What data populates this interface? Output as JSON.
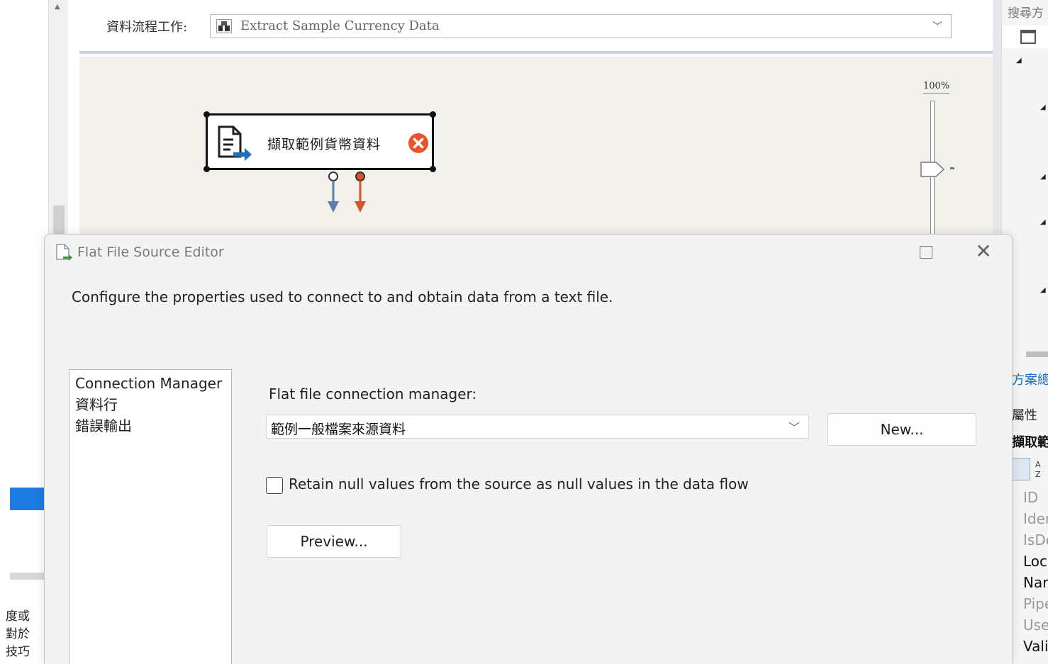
{
  "left_panel": {
    "cut_text": [
      "度或",
      "對於",
      "技巧"
    ]
  },
  "task_bar": {
    "label": "資料流程工作:",
    "selected_task": "Extract Sample Currency Data"
  },
  "canvas": {
    "zoom": "100%",
    "component_label": "擷取範例貨幣資料"
  },
  "right_panel": {
    "search_text": "搜尋方",
    "solution_link": "方案總",
    "properties_header": "屬性",
    "component_name": "擷取範",
    "property_names": [
      "ID",
      "Iden",
      "IsDe",
      "Loc",
      "Nar",
      "Pipe",
      "Use",
      "Vali"
    ]
  },
  "dialog": {
    "title": "Flat File Source Editor",
    "description": "Configure the properties used to connect to and obtain data from a text file.",
    "nav_items": [
      "Connection Manager",
      "資料行",
      "錯誤輸出"
    ],
    "connection_manager_label": "Flat file connection manager:",
    "connection_manager_value": "範例一般檔案來源資料",
    "new_button": "New...",
    "retain_null_label": "Retain null values from the source as null values in the data flow",
    "preview_button": "Preview..."
  },
  "colors": {
    "accent_blue": "#1e7be2",
    "canvas_bg": "#f2f0ea",
    "error_red": "#e8552a",
    "path_blue": "#5b7fa6",
    "path_red": "#d4542a"
  }
}
